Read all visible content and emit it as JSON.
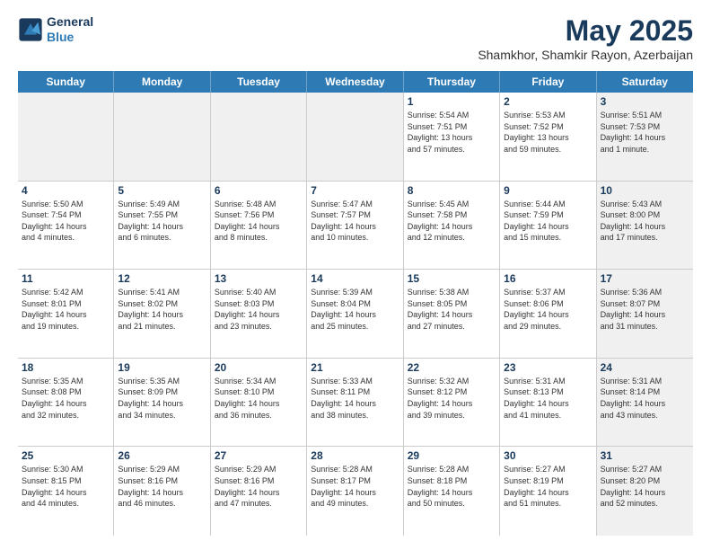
{
  "logo": {
    "line1": "General",
    "line2": "Blue"
  },
  "title": "May 2025",
  "location": "Shamkhor, Shamkir Rayon, Azerbaijan",
  "weekdays": [
    "Sunday",
    "Monday",
    "Tuesday",
    "Wednesday",
    "Thursday",
    "Friday",
    "Saturday"
  ],
  "weeks": [
    [
      {
        "day": "",
        "info": "",
        "shaded": true
      },
      {
        "day": "",
        "info": "",
        "shaded": true
      },
      {
        "day": "",
        "info": "",
        "shaded": true
      },
      {
        "day": "",
        "info": "",
        "shaded": true
      },
      {
        "day": "1",
        "info": "Sunrise: 5:54 AM\nSunset: 7:51 PM\nDaylight: 13 hours\nand 57 minutes.",
        "shaded": false
      },
      {
        "day": "2",
        "info": "Sunrise: 5:53 AM\nSunset: 7:52 PM\nDaylight: 13 hours\nand 59 minutes.",
        "shaded": false
      },
      {
        "day": "3",
        "info": "Sunrise: 5:51 AM\nSunset: 7:53 PM\nDaylight: 14 hours\nand 1 minute.",
        "shaded": true
      }
    ],
    [
      {
        "day": "4",
        "info": "Sunrise: 5:50 AM\nSunset: 7:54 PM\nDaylight: 14 hours\nand 4 minutes.",
        "shaded": false
      },
      {
        "day": "5",
        "info": "Sunrise: 5:49 AM\nSunset: 7:55 PM\nDaylight: 14 hours\nand 6 minutes.",
        "shaded": false
      },
      {
        "day": "6",
        "info": "Sunrise: 5:48 AM\nSunset: 7:56 PM\nDaylight: 14 hours\nand 8 minutes.",
        "shaded": false
      },
      {
        "day": "7",
        "info": "Sunrise: 5:47 AM\nSunset: 7:57 PM\nDaylight: 14 hours\nand 10 minutes.",
        "shaded": false
      },
      {
        "day": "8",
        "info": "Sunrise: 5:45 AM\nSunset: 7:58 PM\nDaylight: 14 hours\nand 12 minutes.",
        "shaded": false
      },
      {
        "day": "9",
        "info": "Sunrise: 5:44 AM\nSunset: 7:59 PM\nDaylight: 14 hours\nand 15 minutes.",
        "shaded": false
      },
      {
        "day": "10",
        "info": "Sunrise: 5:43 AM\nSunset: 8:00 PM\nDaylight: 14 hours\nand 17 minutes.",
        "shaded": true
      }
    ],
    [
      {
        "day": "11",
        "info": "Sunrise: 5:42 AM\nSunset: 8:01 PM\nDaylight: 14 hours\nand 19 minutes.",
        "shaded": false
      },
      {
        "day": "12",
        "info": "Sunrise: 5:41 AM\nSunset: 8:02 PM\nDaylight: 14 hours\nand 21 minutes.",
        "shaded": false
      },
      {
        "day": "13",
        "info": "Sunrise: 5:40 AM\nSunset: 8:03 PM\nDaylight: 14 hours\nand 23 minutes.",
        "shaded": false
      },
      {
        "day": "14",
        "info": "Sunrise: 5:39 AM\nSunset: 8:04 PM\nDaylight: 14 hours\nand 25 minutes.",
        "shaded": false
      },
      {
        "day": "15",
        "info": "Sunrise: 5:38 AM\nSunset: 8:05 PM\nDaylight: 14 hours\nand 27 minutes.",
        "shaded": false
      },
      {
        "day": "16",
        "info": "Sunrise: 5:37 AM\nSunset: 8:06 PM\nDaylight: 14 hours\nand 29 minutes.",
        "shaded": false
      },
      {
        "day": "17",
        "info": "Sunrise: 5:36 AM\nSunset: 8:07 PM\nDaylight: 14 hours\nand 31 minutes.",
        "shaded": true
      }
    ],
    [
      {
        "day": "18",
        "info": "Sunrise: 5:35 AM\nSunset: 8:08 PM\nDaylight: 14 hours\nand 32 minutes.",
        "shaded": false
      },
      {
        "day": "19",
        "info": "Sunrise: 5:35 AM\nSunset: 8:09 PM\nDaylight: 14 hours\nand 34 minutes.",
        "shaded": false
      },
      {
        "day": "20",
        "info": "Sunrise: 5:34 AM\nSunset: 8:10 PM\nDaylight: 14 hours\nand 36 minutes.",
        "shaded": false
      },
      {
        "day": "21",
        "info": "Sunrise: 5:33 AM\nSunset: 8:11 PM\nDaylight: 14 hours\nand 38 minutes.",
        "shaded": false
      },
      {
        "day": "22",
        "info": "Sunrise: 5:32 AM\nSunset: 8:12 PM\nDaylight: 14 hours\nand 39 minutes.",
        "shaded": false
      },
      {
        "day": "23",
        "info": "Sunrise: 5:31 AM\nSunset: 8:13 PM\nDaylight: 14 hours\nand 41 minutes.",
        "shaded": false
      },
      {
        "day": "24",
        "info": "Sunrise: 5:31 AM\nSunset: 8:14 PM\nDaylight: 14 hours\nand 43 minutes.",
        "shaded": true
      }
    ],
    [
      {
        "day": "25",
        "info": "Sunrise: 5:30 AM\nSunset: 8:15 PM\nDaylight: 14 hours\nand 44 minutes.",
        "shaded": false
      },
      {
        "day": "26",
        "info": "Sunrise: 5:29 AM\nSunset: 8:16 PM\nDaylight: 14 hours\nand 46 minutes.",
        "shaded": false
      },
      {
        "day": "27",
        "info": "Sunrise: 5:29 AM\nSunset: 8:16 PM\nDaylight: 14 hours\nand 47 minutes.",
        "shaded": false
      },
      {
        "day": "28",
        "info": "Sunrise: 5:28 AM\nSunset: 8:17 PM\nDaylight: 14 hours\nand 49 minutes.",
        "shaded": false
      },
      {
        "day": "29",
        "info": "Sunrise: 5:28 AM\nSunset: 8:18 PM\nDaylight: 14 hours\nand 50 minutes.",
        "shaded": false
      },
      {
        "day": "30",
        "info": "Sunrise: 5:27 AM\nSunset: 8:19 PM\nDaylight: 14 hours\nand 51 minutes.",
        "shaded": false
      },
      {
        "day": "31",
        "info": "Sunrise: 5:27 AM\nSunset: 8:20 PM\nDaylight: 14 hours\nand 52 minutes.",
        "shaded": true
      }
    ]
  ]
}
